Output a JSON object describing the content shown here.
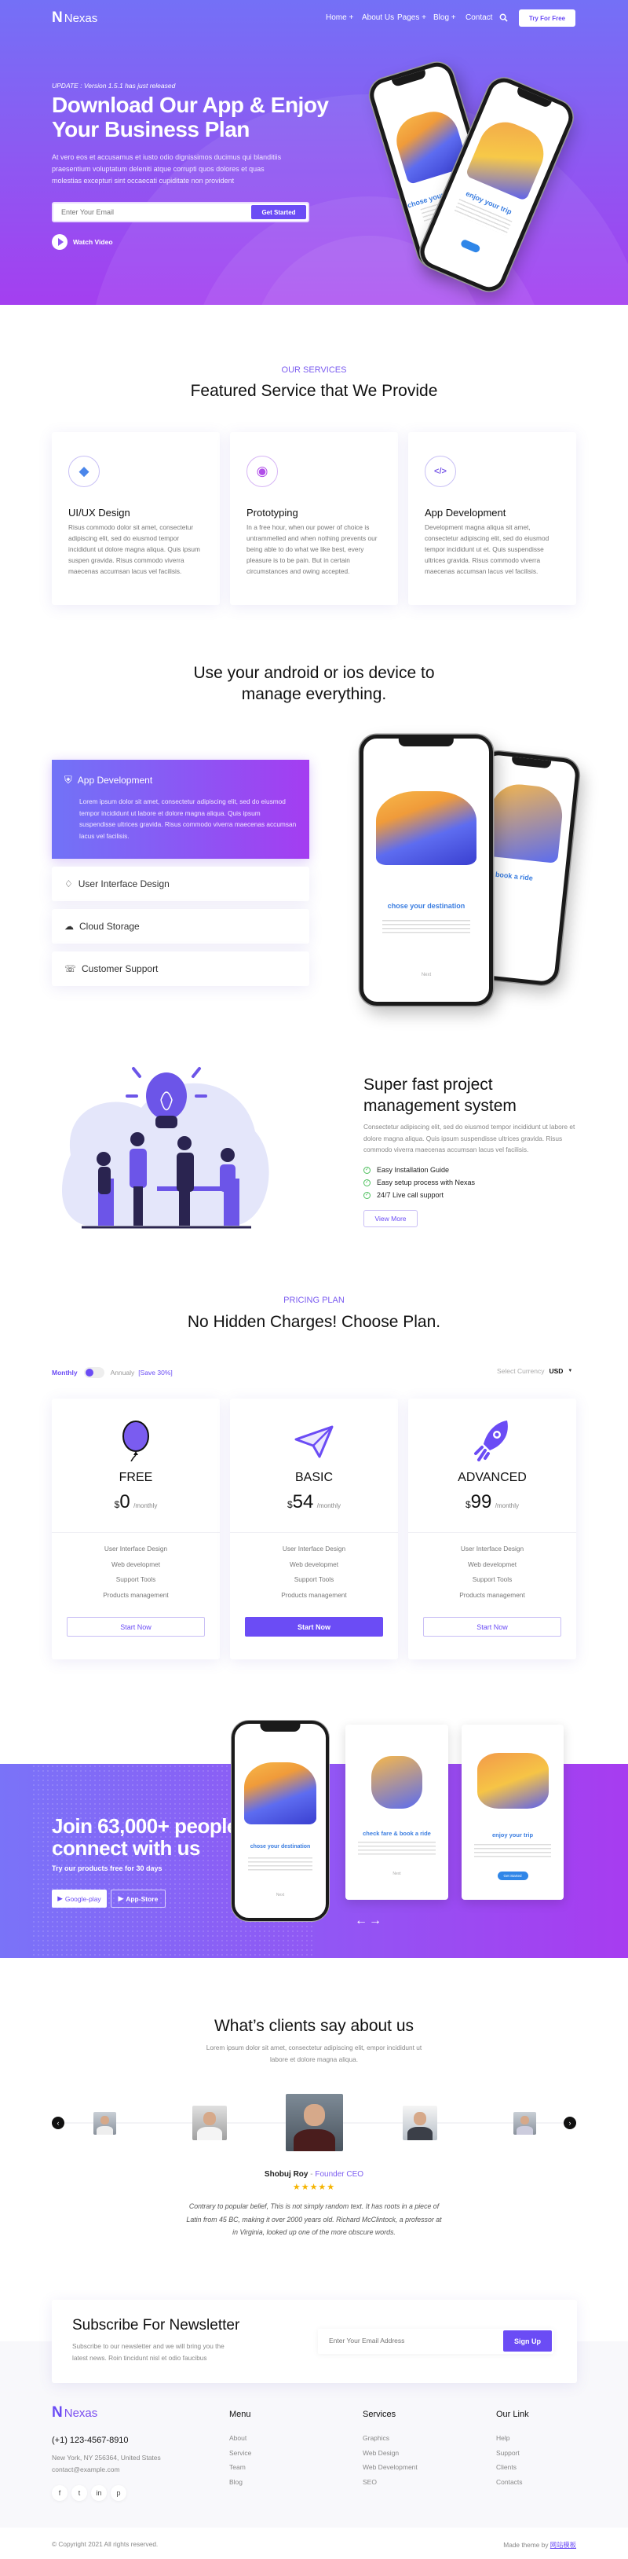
{
  "brand": {
    "name": "Nexas",
    "logo_letter": "N",
    "primary_color": "#6b4cf5",
    "gradient": [
      "#7470f6",
      "#a43ff0"
    ]
  },
  "nav": {
    "items": [
      "Home +",
      "About Us",
      "Pages +",
      "Blog +",
      "Contact"
    ],
    "search_icon": "search-icon",
    "cta": "Try For Free"
  },
  "hero": {
    "update": "UPDATE : Version 1.5.1 has just released",
    "title_line1": "Download Our App & Enjoy",
    "title_line2": "Your Business Plan",
    "paragraph": "At vero eos et accusamus et iusto odio dignissimos ducimus qui blanditiis praesentium voluptatum deleniti atque corrupti quos dolores et quas molestias excepturi sint occaecati cupiditate non provident",
    "email_placeholder": "Enter Your Email",
    "button": "Get Started",
    "watch_video": "Watch Video",
    "phone1_caption": "chose your destination",
    "phone2_caption": "enjoy your trip"
  },
  "services": {
    "kicker": "OUR SERVICES",
    "title": "Featured Service that We Provide",
    "items": [
      {
        "icon": "diamond-icon",
        "title": "UI/UX Design",
        "text": "Risus commodo dolor sit amet, consectetur adipiscing elit, sed do eiusmod tempor incididunt ut dolore magna aliqua. Quis ipsum suspen gravida. Risus commodo viverra maecenas accumsan lacus vel facilisis."
      },
      {
        "icon": "toggle-icon",
        "title": "Prototyping",
        "text": "In a free hour, when our power of choice is untrammelled and when nothing prevents our being able to do what we like best, every pleasure is to be pain. But in certain circumstances and owing accepted."
      },
      {
        "icon": "code-window-icon",
        "title": "App Development",
        "text": "Development magna aliqua sit amet, consectetur adipiscing elit, sed do eiusmod tempor incididunt ut et. Quis suspendisse ultrices gravida. Risus commodo viverra maecenas accumsan lacus vel facilisis."
      }
    ]
  },
  "devices": {
    "title_line1": "Use your android or ios device to",
    "title_line2": "manage everything.",
    "active_tab": {
      "icon": "shield-icon",
      "title": "App Development",
      "text": "Lorem ipsum dolor sit amet, consectetur adipiscing elit, sed do eiusmod tempor incididunt ut labore et dolore magna aliqua. Quis ipsum suspendisse ultrices gravida. Risus commodo viverra maecenas accumsan lacus vel facilisis."
    },
    "tabs": [
      {
        "icon": "diamond-icon",
        "label": "User Interface Design"
      },
      {
        "icon": "cloud-icon",
        "label": "Cloud Storage"
      },
      {
        "icon": "headset-icon",
        "label": "Customer Support"
      }
    ],
    "phone1_caption": "chose your destination",
    "phone1_next": "Next",
    "phone2_caption": "check fare & book a ride"
  },
  "project": {
    "title_line1": "Super fast project",
    "title_line2": "management system",
    "text": "Consectetur adipiscing elit, sed do eiusmod tempor incididunt ut labore et dolore magna aliqua. Quis ipsum suspendisse ultrices gravida. Risus commodo viverra maecenas accumsan lacus vel facilisis.",
    "checks": [
      "Easy Installation Guide",
      "Easy setup process with Nexas",
      "24/7 Live call support"
    ],
    "button": "View More"
  },
  "pricing": {
    "kicker": "PRICING PLAN",
    "title": "No Hidden Charges! Choose Plan.",
    "monthly": "Monthly",
    "annually": "Annualy",
    "save": "[Save 30%]",
    "billing_selected": "Monthly",
    "currency_label": "Select Currency",
    "currency": "USD",
    "plans": [
      {
        "icon": "balloon-icon",
        "name": "FREE",
        "currency_symbol": "$",
        "price": "0",
        "period": "/monthly",
        "features": [
          "User Interface Design",
          "Web developmet",
          "Support Tools",
          "Products management"
        ],
        "button": "Start Now",
        "highlighted": false
      },
      {
        "icon": "paper-plane-icon",
        "name": "BASIC",
        "currency_symbol": "$",
        "price": "54",
        "period": "/monthly",
        "features": [
          "User Interface Design",
          "Web developmet",
          "Support Tools",
          "Products management"
        ],
        "button": "Start Now",
        "highlighted": true
      },
      {
        "icon": "rocket-icon",
        "name": "ADVANCED",
        "currency_symbol": "$",
        "price": "99",
        "period": "/monthly",
        "features": [
          "User Interface Design",
          "Web developmet",
          "Support Tools",
          "Products management"
        ],
        "button": "Start Now",
        "highlighted": false
      }
    ]
  },
  "cta": {
    "title_line1": "Join 63,000+ people",
    "title_line2": "connect with us",
    "subtitle": "Try our products free for 30 days",
    "google_play": "Google-play",
    "app_store": "App-Store",
    "screens": [
      "chose your destination",
      "check fare & book a ride",
      "enjoy your trip"
    ],
    "screen_next": "Next",
    "screen_button": "Get Started"
  },
  "testimonials": {
    "title": "What’s clients say about us",
    "subtitle": "Lorem ipsum dolor sit amet, consectetur adipiscing elit, empor incididunt ut labore et dolore magna aliqua.",
    "name": "Shobuj Roy",
    "separator": " - ",
    "role": "Founder CEO",
    "rating": 5,
    "stars": "★★★★★",
    "quote": "Contrary to popular belief, This is not simply random text. It has roots in a piece of Latin from 45 BC, making it over 2000 years old. Richard McClintock, a professor at in Virginia, looked up one of the more obscure words.",
    "star_color": "#f5b400"
  },
  "newsletter": {
    "title": "Subscribe For Newsletter",
    "text": "Subscribe to our newsletter and we will bring you the latest news. Roin tincidunt nisl et odio faucibus",
    "placeholder": "Enter Your Email Address",
    "button": "Sign Up"
  },
  "footer": {
    "phone": "(+1) 123-4567-8910",
    "address": "New York, NY 256364, United States",
    "email": "contact@example.com",
    "social": [
      "facebook-icon",
      "twitter-icon",
      "linkedin-icon",
      "pinterest-icon"
    ],
    "columns": [
      {
        "title": "Menu",
        "links": [
          "About",
          "Service",
          "Team",
          "Blog"
        ]
      },
      {
        "title": "Services",
        "links": [
          "Graphics",
          "Web Design",
          "Web Development",
          "SEO"
        ]
      },
      {
        "title": "Our Link",
        "links": [
          "Help",
          "Support",
          "Clients",
          "Contacts"
        ]
      }
    ],
    "copyright": "© Copyright 2021 All rights reserved.",
    "made_by": "Made theme by",
    "made_by_link": "网站模板"
  }
}
